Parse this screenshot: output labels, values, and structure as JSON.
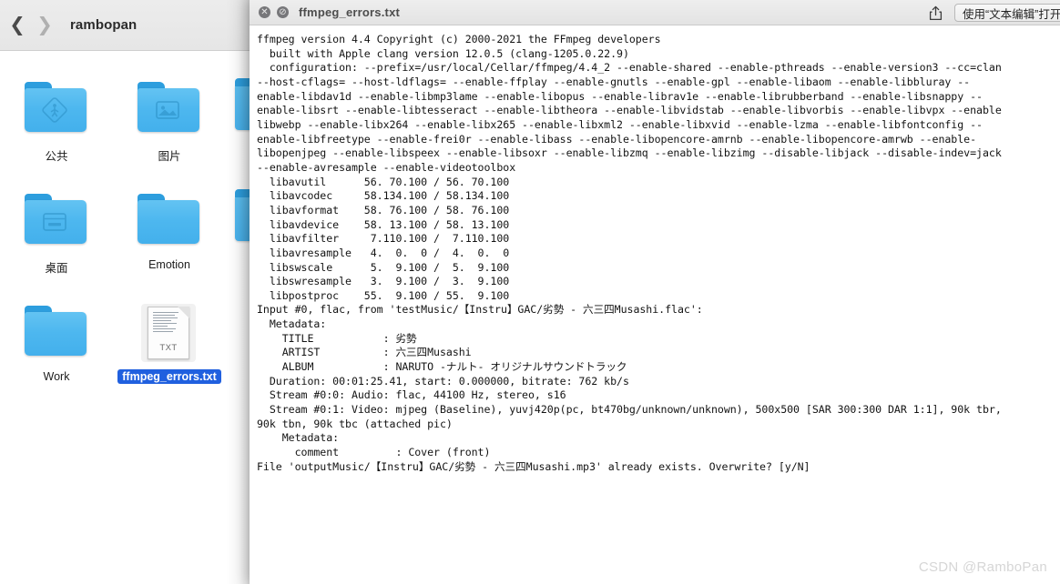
{
  "finder": {
    "title": "rambopan",
    "nav": {
      "back_icon": "chevron-left-icon",
      "forward_icon": "chevron-right-icon"
    },
    "items": [
      {
        "label": "公共",
        "kind": "folder",
        "glyph": "public-folder-icon",
        "selected": false
      },
      {
        "label": "图片",
        "kind": "folder",
        "glyph": "pictures-folder-icon",
        "selected": false
      },
      {
        "label": "桌面",
        "kind": "folder",
        "glyph": "desktop-folder-icon",
        "selected": false
      },
      {
        "label": "Emotion",
        "kind": "folder",
        "glyph": "plain-folder-icon",
        "selected": false
      },
      {
        "label": "Work",
        "kind": "folder",
        "glyph": "plain-folder-icon",
        "selected": false
      },
      {
        "label": "ffmpeg_errors.txt",
        "kind": "textfile",
        "glyph": "txt-document-icon",
        "selected": true,
        "badge": "TXT"
      }
    ],
    "selection_color": "#2060df"
  },
  "text_window": {
    "title": "ffmpeg_errors.txt",
    "close_glyph": "✕",
    "minimize_glyph": "⊘",
    "share_icon": "share-icon",
    "open_with_label": "使用“文本编辑”打开",
    "content": "ffmpeg version 4.4 Copyright (c) 2000-2021 the FFmpeg developers\n  built with Apple clang version 12.0.5 (clang-1205.0.22.9)\n  configuration: --prefix=/usr/local/Cellar/ffmpeg/4.4_2 --enable-shared --enable-pthreads --enable-version3 --cc=clan\n--host-cflags= --host-ldflags= --enable-ffplay --enable-gnutls --enable-gpl --enable-libaom --enable-libbluray --\nenable-libdav1d --enable-libmp3lame --enable-libopus --enable-librav1e --enable-librubberband --enable-libsnappy --\nenable-libsrt --enable-libtesseract --enable-libtheora --enable-libvidstab --enable-libvorbis --enable-libvpx --enable\nlibwebp --enable-libx264 --enable-libx265 --enable-libxml2 --enable-libxvid --enable-lzma --enable-libfontconfig --\nenable-libfreetype --enable-frei0r --enable-libass --enable-libopencore-amrnb --enable-libopencore-amrwb --enable-\nlibopenjpeg --enable-libspeex --enable-libsoxr --enable-libzmq --enable-libzimg --disable-libjack --disable-indev=jack\n--enable-avresample --enable-videotoolbox\n  libavutil      56. 70.100 / 56. 70.100\n  libavcodec     58.134.100 / 58.134.100\n  libavformat    58. 76.100 / 58. 76.100\n  libavdevice    58. 13.100 / 58. 13.100\n  libavfilter     7.110.100 /  7.110.100\n  libavresample   4.  0.  0 /  4.  0.  0\n  libswscale      5.  9.100 /  5.  9.100\n  libswresample   3.  9.100 /  3.  9.100\n  libpostproc    55.  9.100 / 55.  9.100\nInput #0, flac, from 'testMusic/【Instru】GAC/劣勢 - 六三四Musashi.flac':\n  Metadata:\n    TITLE           : 劣勢\n    ARTIST          : 六三四Musashi\n    ALBUM           : NARUTO -ナルト- オリジナルサウンドトラック\n  Duration: 00:01:25.41, start: 0.000000, bitrate: 762 kb/s\n  Stream #0:0: Audio: flac, 44100 Hz, stereo, s16\n  Stream #0:1: Video: mjpeg (Baseline), yuvj420p(pc, bt470bg/unknown/unknown), 500x500 [SAR 300:300 DAR 1:1], 90k tbr,\n90k tbn, 90k tbc (attached pic)\n    Metadata:\n      comment         : Cover (front)\nFile 'outputMusic/【Instru】GAC/劣勢 - 六三四Musashi.mp3' already exists. Overwrite? [y/N]"
  },
  "watermark": {
    "text": "CSDN @RamboPan"
  }
}
